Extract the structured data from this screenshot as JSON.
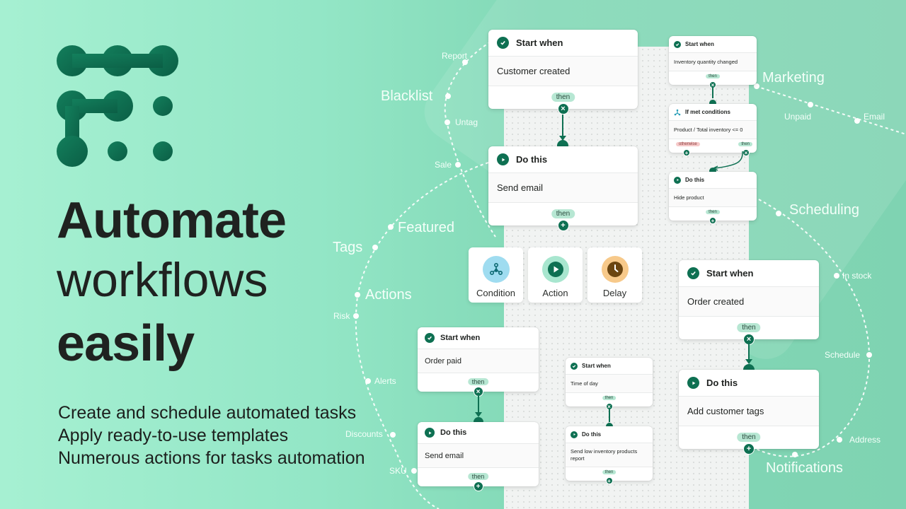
{
  "brand": {
    "logo_icon": "dotted-network-logo",
    "primary_color": "#0e7052",
    "background_color": "#93e6c6"
  },
  "headline": {
    "line1": "Automate",
    "line2": "workflows",
    "line3": "easily"
  },
  "features": [
    "Create and schedule automated tasks",
    "Apply ready-to-use templates",
    "Numerous actions for tasks automation"
  ],
  "orbit_labels": {
    "big": [
      "Blacklist",
      "Featured",
      "Tags",
      "Actions",
      "Marketing",
      "Scheduling",
      "Notifications"
    ],
    "small": [
      "Report",
      "Untag",
      "Sale",
      "Risk",
      "Alerts",
      "Discounts",
      "SKU",
      "Unpaid",
      "Email",
      "In stock",
      "Schedule",
      "Address"
    ]
  },
  "palette": [
    {
      "label": "Condition",
      "icon": "condition-branch-icon",
      "color": "#9fdcf0"
    },
    {
      "label": "Action",
      "icon": "play-icon",
      "color": "#a8e6cf"
    },
    {
      "label": "Delay",
      "icon": "clock-icon",
      "color": "#f7c98a"
    }
  ],
  "flows": {
    "customer": {
      "trigger": {
        "title": "Start when",
        "value": "Customer created",
        "then": "then"
      },
      "action": {
        "title": "Do this",
        "value": "Send email",
        "then": "then"
      }
    },
    "inventory": {
      "trigger": {
        "title": "Start when",
        "value": "Inventory quantity changed",
        "then": "then"
      },
      "condition": {
        "title": "If met conditions",
        "value": "Product / Total inventory <= 0",
        "otherwise": "otherwise",
        "then": "then"
      },
      "action": {
        "title": "Do this",
        "value": "Hide product",
        "then": "then"
      }
    },
    "order_paid": {
      "trigger": {
        "title": "Start when",
        "value": "Order paid",
        "then": "then"
      },
      "action": {
        "title": "Do this",
        "value": "Send email",
        "then": "then"
      }
    },
    "time_of_day": {
      "trigger": {
        "title": "Start when",
        "value": "Time of day",
        "then": "then"
      },
      "action": {
        "title": "Do this",
        "value": "Send low inventory products report",
        "then": "then"
      }
    },
    "order_created": {
      "trigger": {
        "title": "Start when",
        "value": "Order created",
        "then": "then"
      },
      "action": {
        "title": "Do this",
        "value": "Add customer tags",
        "then": "then"
      }
    }
  }
}
